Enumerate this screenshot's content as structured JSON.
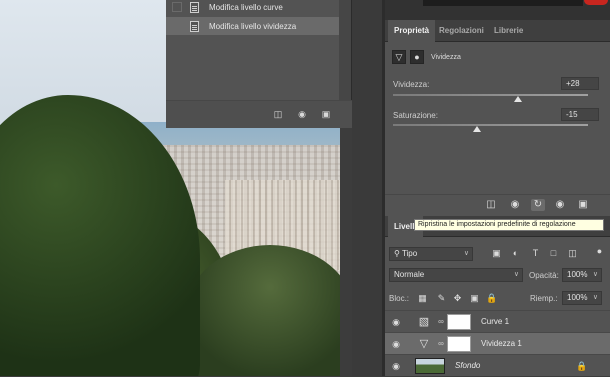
{
  "history": {
    "items": [
      {
        "label": "Modifica livello curve",
        "selected": false
      },
      {
        "label": "Modifica livello vividezza",
        "selected": true
      }
    ],
    "footer_icons": [
      "new-document-from-state-icon",
      "camera-snapshot-icon",
      "trash-icon"
    ]
  },
  "panel_tabs": [
    "Proprietà",
    "Regolazioni",
    "Librerie"
  ],
  "properties": {
    "title": "Vividezza",
    "sliders": [
      {
        "label": "Vividezza:",
        "value": "+28",
        "position": 0.64
      },
      {
        "label": "Saturazione:",
        "value": "-15",
        "position": 0.43
      }
    ],
    "footer_icons": [
      "clip-to-layer-icon",
      "view-previous-state-icon",
      "reset-icon",
      "visibility-icon",
      "trash-icon"
    ]
  },
  "tooltip": "Ripristina le impostazioni predefinite di regolazione",
  "layers": {
    "tab": "Livelli",
    "filter_kind": "Tipo",
    "blend_mode": "Normale",
    "opacity_label": "Opacità:",
    "opacity_value": "100%",
    "lock_label": "Bloc.:",
    "fill_label": "Riemp.:",
    "fill_value": "100%",
    "rows": [
      {
        "name": "Curve 1",
        "type": "curves",
        "selected": false
      },
      {
        "name": "Vividezza 1",
        "type": "vibrance",
        "selected": true
      },
      {
        "name": "Sfondo",
        "type": "background",
        "selected": false
      }
    ]
  },
  "colors": {
    "panel": "#535353",
    "tab_bar": "#3f3f3f",
    "selected_row": "#6b6b6b",
    "tooltip_bg": "#ffffe1"
  }
}
